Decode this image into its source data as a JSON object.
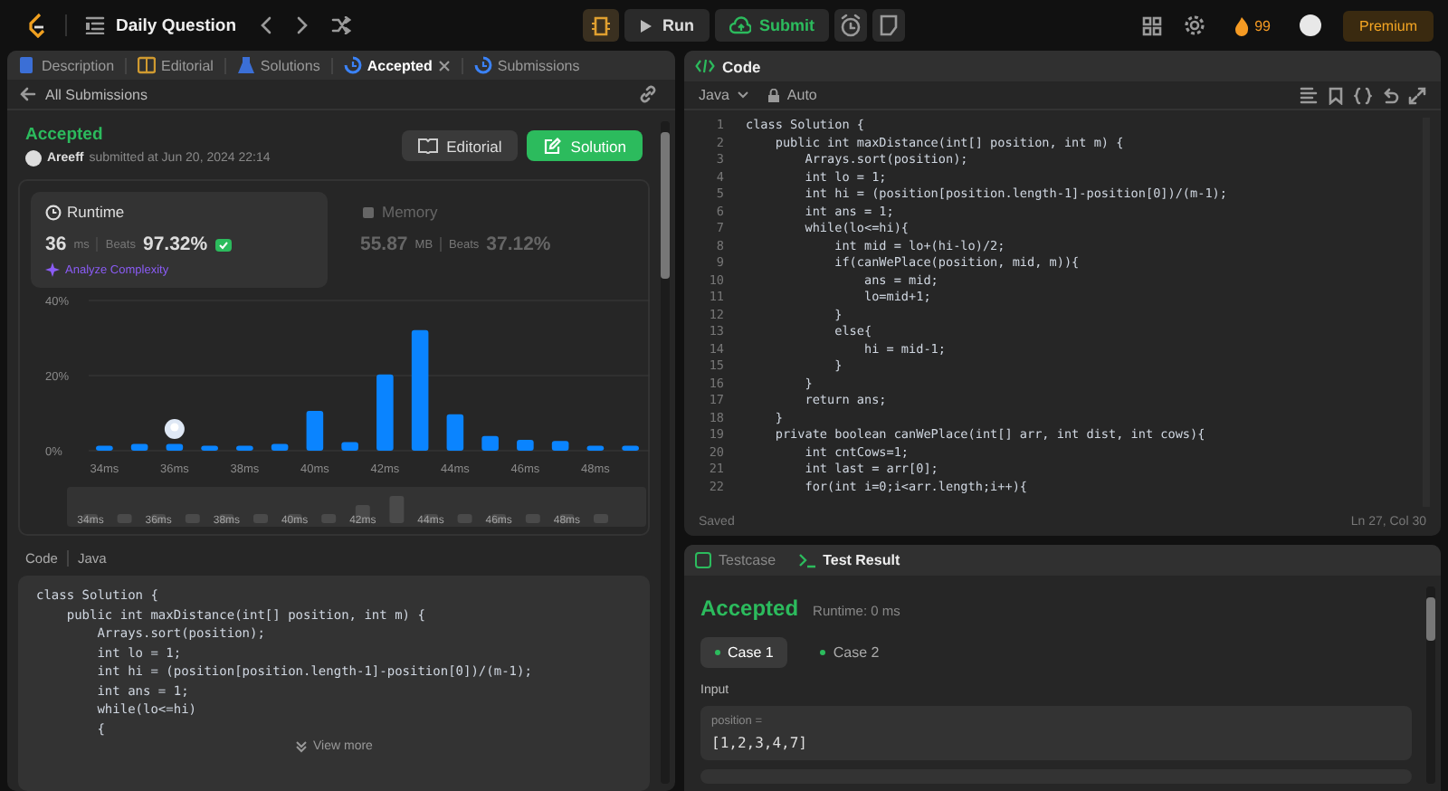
{
  "top_bar": {
    "title": "Daily Question",
    "run": "Run",
    "submit": "Submit",
    "streak": "99",
    "premium": "Premium"
  },
  "left_tabs": [
    {
      "label": "Description",
      "kind": "doc",
      "selected": false
    },
    {
      "label": "Editorial",
      "kind": "book",
      "selected": false
    },
    {
      "label": "Solutions",
      "kind": "flask",
      "selected": false
    },
    {
      "label": "Accepted",
      "kind": "history",
      "selected": true
    },
    {
      "label": "Submissions",
      "kind": "history",
      "selected": false
    }
  ],
  "submission": {
    "back": "All Submissions",
    "status": "Accepted",
    "user": "Areeff",
    "submitted": "submitted at Jun 20, 2024 22:14",
    "buttons": [
      {
        "label": "Editorial",
        "kind": "secondary"
      },
      {
        "label": "Solution",
        "kind": "primary"
      }
    ],
    "metrics": [
      {
        "title": "Runtime",
        "value": "36",
        "unit": "ms",
        "beats_label": "Beats",
        "beats": "97.32%",
        "selected": true,
        "link": "Analyze Complexity"
      },
      {
        "title": "Memory",
        "value": "55.87",
        "unit": "MB",
        "beats_label": "Beats",
        "beats": "37.12%",
        "selected": false
      }
    ],
    "chart_data": {
      "type": "bar",
      "x": [
        34,
        35,
        36,
        37,
        38,
        39,
        40,
        41,
        42,
        43,
        44,
        45,
        46,
        47,
        48,
        49
      ],
      "xlim": [
        33.5,
        49.5
      ],
      "series": [
        {
          "color": "#0a84ff",
          "values": [
            1.3,
            1.8,
            1.8,
            1.3,
            1.3,
            1.8,
            10.6,
            2.3,
            20.3,
            32.1,
            9.7,
            3.9,
            2.9,
            2.6,
            1.3,
            1.3
          ]
        }
      ],
      "ylim": [
        0,
        40
      ],
      "yticks": [
        {
          "value": 0,
          "label": "0%"
        },
        {
          "value": 20,
          "label": "20%"
        },
        {
          "value": 40,
          "label": "40%"
        }
      ],
      "xticks": [
        {
          "value": 34,
          "label": "34ms"
        },
        {
          "value": 36,
          "label": "36ms"
        },
        {
          "value": 38,
          "label": "38ms"
        },
        {
          "value": 40,
          "label": "40ms"
        },
        {
          "value": 42,
          "label": "42ms"
        },
        {
          "value": 44,
          "label": "44ms"
        },
        {
          "value": 46,
          "label": "46ms"
        },
        {
          "value": 48,
          "label": "48ms"
        }
      ]
    },
    "navigator": {
      "labels": [
        "34ms",
        "36ms",
        "38ms",
        "40ms",
        "42ms",
        "44ms",
        "46ms",
        "48ms"
      ]
    }
  },
  "code_preview": {
    "label": "Code",
    "language": "Java",
    "more": "View more",
    "lines": [
      "class Solution {",
      "    public int maxDistance(int[] position, int m) {",
      "        Arrays.sort(position);",
      "        int lo = 1;",
      "        int hi = (position[position.length-1]-position[0])/(m-1);",
      "        int ans = 1;",
      "        while(lo<=hi)",
      "        {"
    ]
  },
  "editor": {
    "title": "Code",
    "language": "Java",
    "mode": "Auto",
    "status": "Saved",
    "cursor": "Ln 27, Col 30",
    "lines": [
      {
        "n": "1",
        "code": "class Solution {"
      },
      {
        "n": "2",
        "code": "    public int maxDistance(int[] position, int m) {"
      },
      {
        "n": "3",
        "code": "        Arrays.sort(position);"
      },
      {
        "n": "4",
        "code": "        int lo = 1;"
      },
      {
        "n": "5",
        "code": "        int hi = (position[position.length-1]-position[0])/(m-1);"
      },
      {
        "n": "6",
        "code": "        int ans = 1;"
      },
      {
        "n": "7",
        "code": "        while(lo<=hi){"
      },
      {
        "n": "8",
        "code": "            int mid = lo+(hi-lo)/2;"
      },
      {
        "n": "9",
        "code": "            if(canWePlace(position, mid, m)){"
      },
      {
        "n": "10",
        "code": "                ans = mid;"
      },
      {
        "n": "11",
        "code": "                lo=mid+1;"
      },
      {
        "n": "12",
        "code": "            }"
      },
      {
        "n": "13",
        "code": "            else{"
      },
      {
        "n": "14",
        "code": "                hi = mid-1;"
      },
      {
        "n": "15",
        "code": "            }"
      },
      {
        "n": "16",
        "code": "        }"
      },
      {
        "n": "17",
        "code": "        return ans;"
      },
      {
        "n": "18",
        "code": "    }"
      },
      {
        "n": "19",
        "code": "    private boolean canWePlace(int[] arr, int dist, int cows){"
      },
      {
        "n": "20",
        "code": "        int cntCows=1;"
      },
      {
        "n": "21",
        "code": "        int last = arr[0];"
      },
      {
        "n": "22",
        "code": "        for(int i=0;i<arr.length;i++){"
      }
    ]
  },
  "console": {
    "tabs": [
      {
        "label": "Testcase",
        "selected": false
      },
      {
        "label": "Test Result",
        "selected": true
      }
    ],
    "status": "Accepted",
    "runtime": "Runtime: 0 ms",
    "cases": [
      {
        "label": "Case 1",
        "selected": true,
        "color": "#2cbb5d"
      },
      {
        "label": "Case 2",
        "selected": false,
        "color": "#2cbb5d"
      }
    ],
    "input_label": "Input",
    "inputs": [
      {
        "name": "position =",
        "value": "[1,2,3,4,7]"
      }
    ]
  }
}
